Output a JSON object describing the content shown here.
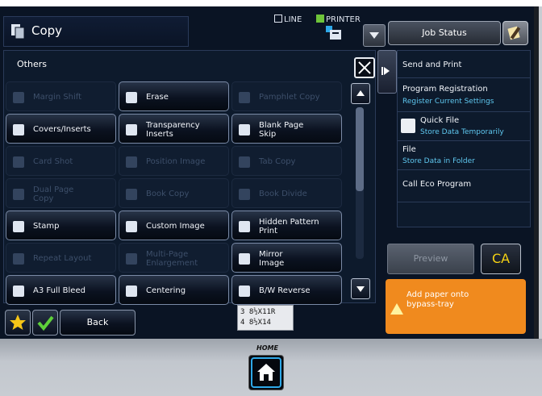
{
  "header": {
    "title": "Copy",
    "mode_line": "LINE",
    "mode_printer": "PRINTER",
    "job_status_label": "Job Status"
  },
  "panel": {
    "heading": "Others",
    "buttons": [
      {
        "label": "Margin Shift",
        "enabled": false
      },
      {
        "label": "Erase",
        "enabled": true
      },
      {
        "label": "Pamphlet Copy",
        "enabled": false
      },
      {
        "label": "Covers/Inserts",
        "enabled": true
      },
      {
        "label": "Transparency\nInserts",
        "enabled": true
      },
      {
        "label": "Blank Page\nSkip",
        "enabled": true
      },
      {
        "label": "Card Shot",
        "enabled": false
      },
      {
        "label": "Position Image",
        "enabled": false
      },
      {
        "label": "Tab Copy",
        "enabled": false
      },
      {
        "label": "Dual Page\nCopy",
        "enabled": false
      },
      {
        "label": "Book Copy",
        "enabled": false
      },
      {
        "label": "Book Divide",
        "enabled": false
      },
      {
        "label": "Stamp",
        "enabled": true
      },
      {
        "label": "Custom Image",
        "enabled": true
      },
      {
        "label": "Hidden Pattern\nPrint",
        "enabled": true
      },
      {
        "label": "Repeat Layout",
        "enabled": false
      },
      {
        "label": "Multi-Page\nEnlargement",
        "enabled": false
      },
      {
        "label": "Mirror\nImage",
        "enabled": true
      },
      {
        "label": "A3 Full Bleed",
        "enabled": true
      },
      {
        "label": "Centering",
        "enabled": true
      },
      {
        "label": "B/W Reverse",
        "enabled": true
      }
    ]
  },
  "footer": {
    "back_label": "Back",
    "tray_line1": "3 8½X11R",
    "tray_line2": "4 8½X14",
    "home_label": "HOME"
  },
  "right_panel": {
    "items": [
      {
        "title": "Send and Print",
        "sub": ""
      },
      {
        "title": "Program Registration",
        "sub": "Register Current Settings"
      },
      {
        "title": "Quick File",
        "sub": "Store Data Temporarily"
      },
      {
        "title": "File",
        "sub": "Store Data in Folder"
      },
      {
        "title": "Call Eco Program",
        "sub": ""
      }
    ],
    "preview_label": "Preview",
    "ca_label": "CA",
    "alert_text": "Add paper onto\nbypass-tray"
  },
  "colors": {
    "accent_link": "#5fc8f0",
    "alert": "#f08a1e",
    "ca_text": "#f5d213"
  }
}
